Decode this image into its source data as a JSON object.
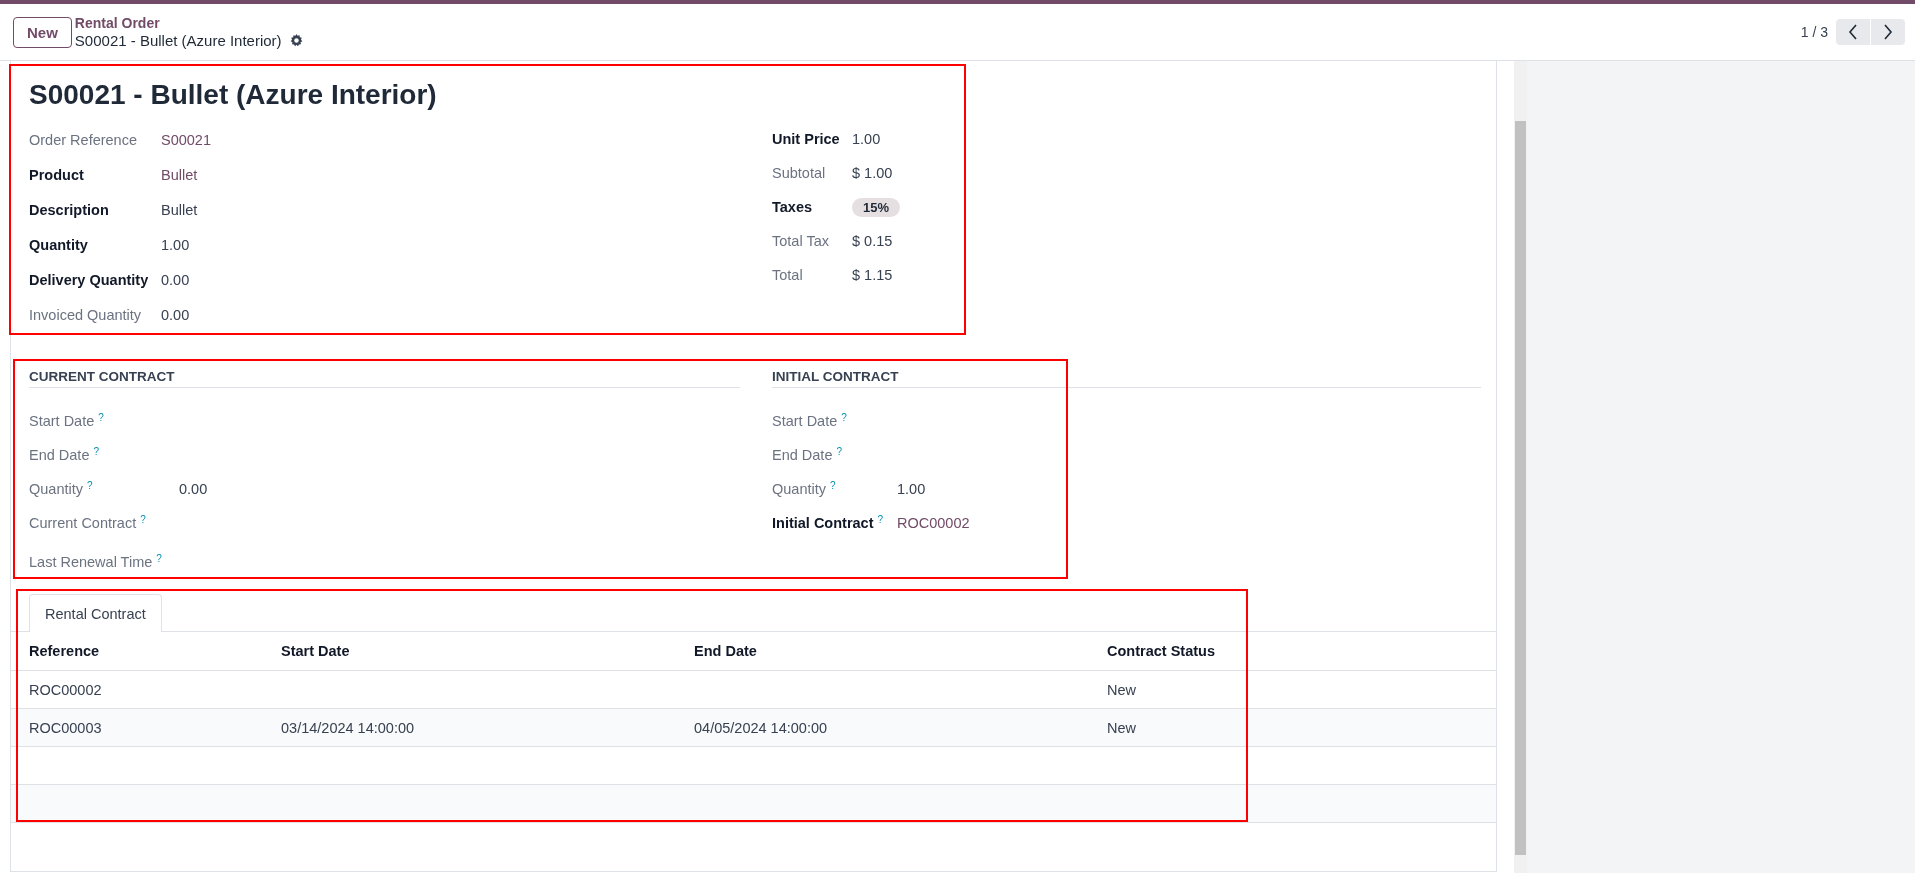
{
  "control_panel": {
    "new_button": "New",
    "breadcrumb_parent": "Rental Order",
    "breadcrumb_current": "S00021 - Bullet (Azure Interior)",
    "pager": "1 / 3"
  },
  "details": {
    "highlighted": true,
    "title": "S00021 - Bullet (Azure Interior)",
    "left_fields": [
      {
        "label": "Order Reference",
        "emphasis": false,
        "kind": "link",
        "value": "S00021"
      },
      {
        "label": "Product",
        "emphasis": true,
        "kind": "link",
        "value": "Bullet"
      },
      {
        "label": "Description",
        "emphasis": true,
        "kind": "text",
        "value": "Bullet"
      },
      {
        "label": "Quantity",
        "emphasis": true,
        "kind": "text",
        "value": "1.00"
      },
      {
        "label": "Delivery Quantity",
        "emphasis": true,
        "kind": "text",
        "value": "0.00"
      },
      {
        "label": "Invoiced Quantity",
        "emphasis": false,
        "kind": "text",
        "value": "0.00"
      }
    ],
    "right_fields": [
      {
        "label": "Unit Price",
        "emphasis": true,
        "kind": "text",
        "value": "1.00"
      },
      {
        "label": "Subtotal",
        "emphasis": false,
        "kind": "text",
        "value": "$ 1.00"
      },
      {
        "label": "Taxes",
        "emphasis": true,
        "kind": "tag",
        "value": "15%"
      },
      {
        "label": "Total Tax",
        "emphasis": false,
        "kind": "text",
        "value": "$ 0.15"
      },
      {
        "label": "Total",
        "emphasis": false,
        "kind": "text",
        "value": "$ 1.15"
      }
    ]
  },
  "contracts": {
    "highlighted": true,
    "groups": [
      {
        "heading": "CURRENT CONTRACT",
        "fields": [
          {
            "label": "Start Date",
            "emphasis": false,
            "help": "?"
          },
          {
            "label": "End Date",
            "emphasis": false,
            "help": "?"
          },
          {
            "label": "Quantity",
            "emphasis": false,
            "help": "?",
            "kind": "text",
            "value": "0.00"
          },
          {
            "label": "Current Contract",
            "emphasis": false,
            "help": "?"
          },
          {
            "label": "Last Renewal Time",
            "emphasis": false,
            "help": "?"
          }
        ]
      },
      {
        "heading": "INITIAL CONTRACT",
        "fields": [
          {
            "label": "Start Date",
            "emphasis": false,
            "help": "?"
          },
          {
            "label": "End Date",
            "emphasis": false,
            "help": "?"
          },
          {
            "label": "Quantity",
            "emphasis": false,
            "help": "?",
            "kind": "text",
            "value": "1.00"
          },
          {
            "label": "Initial Contract",
            "emphasis": true,
            "help": "?",
            "kind": "link",
            "value": "ROC00002"
          }
        ]
      }
    ]
  },
  "notebook": {
    "highlighted": true,
    "tabs": [
      {
        "label": "Rental Contract",
        "selected": true
      }
    ],
    "table": {
      "columns": [
        "Reference",
        "Start Date",
        "End Date",
        "Contract Status"
      ],
      "rows": [
        {
          "cells": [
            "ROC00002",
            null,
            null,
            "New"
          ]
        },
        {
          "cells": [
            "ROC00003",
            "03/14/2024 14:00:00",
            "04/05/2024 14:00:00",
            "New"
          ]
        }
      ]
    }
  }
}
